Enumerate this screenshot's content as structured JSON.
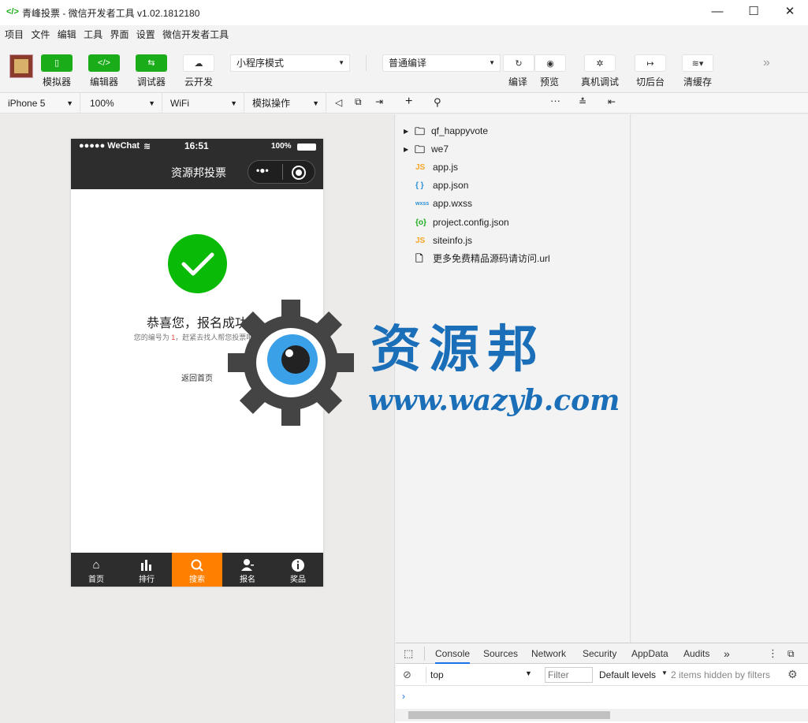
{
  "window": {
    "title": "青峰投票 - 微信开发者工具 v1.02.1812180"
  },
  "menu": [
    "项目",
    "文件",
    "编辑",
    "工具",
    "界面",
    "设置",
    "微信开发者工具"
  ],
  "toolbar": {
    "simulator": "模拟器",
    "editor": "编辑器",
    "debugger": "调试器",
    "cloud": "云开发",
    "mode": "小程序模式",
    "compile_mode": "普通编译",
    "compile": "编译",
    "preview": "预览",
    "remote_debug": "真机调试",
    "background": "切后台",
    "clear_cache": "清缓存"
  },
  "subbar": {
    "device": "iPhone 5",
    "zoom": "100%",
    "network": "WiFi",
    "operation": "模拟操作"
  },
  "phone": {
    "carrier": "●●●●● WeChat",
    "time": "16:51",
    "battery": "100%",
    "nav_title": "资源邦投票",
    "success_title": "恭喜您，报名成功",
    "desc_prefix": "您的编号为",
    "desc_number": "1",
    "desc_suffix": "，赶紧去找人帮您投票吧！",
    "back_link": "返回首页",
    "tabs": [
      {
        "icon": "home-icon",
        "glyph": "⌂",
        "label": "首页"
      },
      {
        "icon": "bar-chart-icon",
        "glyph": "▮",
        "label": "排行"
      },
      {
        "icon": "search-icon",
        "glyph": "⚲",
        "label": "搜索"
      },
      {
        "icon": "user-add-icon",
        "glyph": "👤",
        "label": "报名"
      },
      {
        "icon": "info-icon",
        "glyph": "i",
        "label": "奖品"
      }
    ],
    "active_tab_color": "#ff7f00"
  },
  "files": [
    {
      "name": "qf_happyvote",
      "type": "folder"
    },
    {
      "name": "we7",
      "type": "folder"
    },
    {
      "name": "app.js",
      "type": "js"
    },
    {
      "name": "app.json",
      "type": "json"
    },
    {
      "name": "app.wxss",
      "type": "wxss"
    },
    {
      "name": "project.config.json",
      "type": "config"
    },
    {
      "name": "siteinfo.js",
      "type": "js"
    },
    {
      "name": "更多免费精品源码请访问.url",
      "type": "file"
    }
  ],
  "devtools": {
    "tabs": [
      "Console",
      "Sources",
      "Network",
      "Security",
      "AppData",
      "Audits"
    ],
    "active_tab": "Console",
    "context": "top",
    "filter_placeholder": "Filter",
    "levels": "Default levels",
    "hidden_note": "2 items hidden by filters"
  },
  "watermark": {
    "name": "资源邦",
    "url": "www.wazyb.com"
  },
  "colors": {
    "brand_green": "#1aad19",
    "accent_orange": "#ff7f00",
    "nav_dark": "#2d2d2d",
    "watermark_blue": "#1a6fb8"
  }
}
